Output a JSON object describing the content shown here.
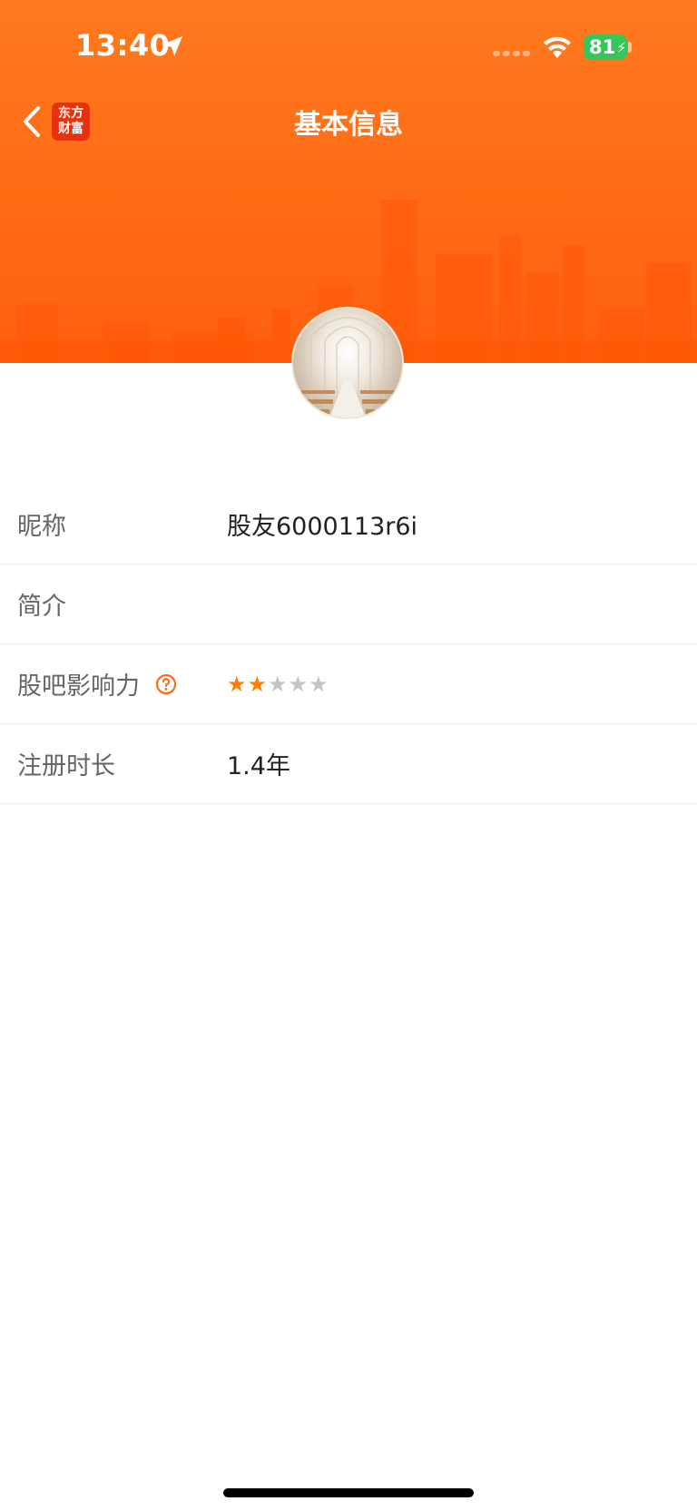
{
  "status_bar": {
    "time": "13:40",
    "battery": "81"
  },
  "header": {
    "logo_text": "东方财富",
    "title": "基本信息"
  },
  "rows": [
    {
      "label": "昵称",
      "value": "股友6000113r6i"
    },
    {
      "label": "简介",
      "value": ""
    },
    {
      "label": "股吧影响力",
      "rating": 2,
      "max_rating": 5
    },
    {
      "label": "注册时长",
      "value": "1.4年"
    }
  ],
  "colors": {
    "accent": "#ff6a14",
    "star_on": "#ff7f00",
    "star_off": "#c4c4c4"
  },
  "icons": [
    "location-arrow-icon",
    "signal-icon",
    "wifi-icon",
    "back-chevron-icon",
    "help-icon",
    "star-icon"
  ]
}
